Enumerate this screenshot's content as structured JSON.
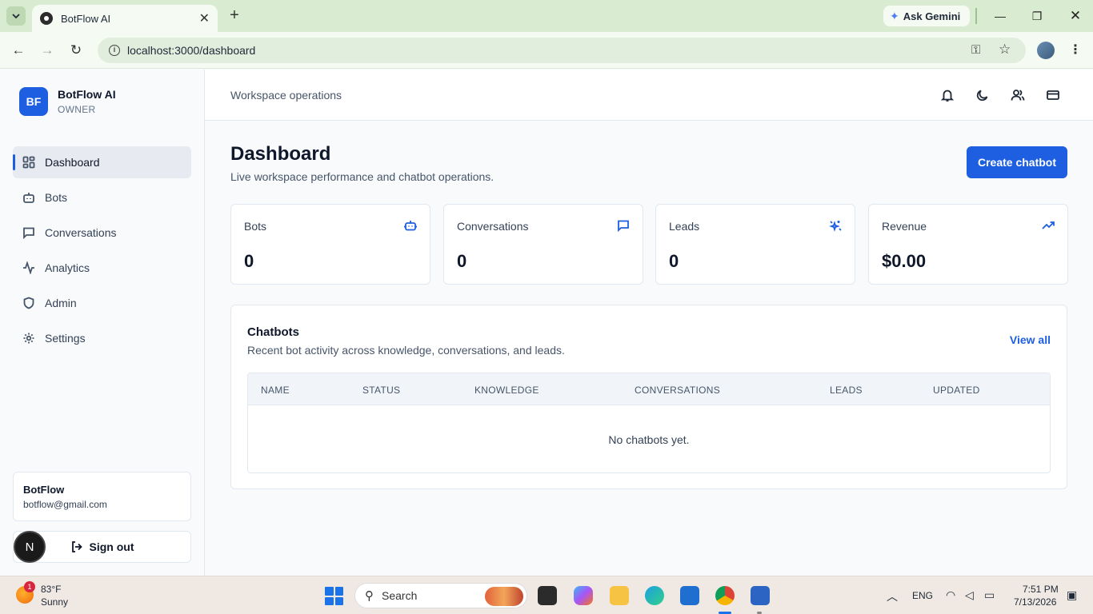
{
  "browser": {
    "tab_title": "BotFlow AI",
    "url": "localhost:3000/dashboard",
    "gemini_label": "Ask Gemini"
  },
  "sidebar": {
    "logo_initials": "BF",
    "brand_name": "BotFlow AI",
    "role": "OWNER",
    "items": [
      {
        "label": "Dashboard",
        "icon": "dashboard-icon"
      },
      {
        "label": "Bots",
        "icon": "bot-icon"
      },
      {
        "label": "Conversations",
        "icon": "message-icon"
      },
      {
        "label": "Analytics",
        "icon": "activity-icon"
      },
      {
        "label": "Admin",
        "icon": "shield-icon"
      },
      {
        "label": "Settings",
        "icon": "gear-icon"
      }
    ],
    "user_name": "BotFlow",
    "user_email": "botflow@gmail.com",
    "signout_label": "Sign out",
    "next_badge": "N"
  },
  "topbar": {
    "section": "Workspace operations"
  },
  "page": {
    "title": "Dashboard",
    "subtitle": "Live workspace performance and chatbot operations.",
    "create_label": "Create chatbot"
  },
  "stats": [
    {
      "label": "Bots",
      "value": "0",
      "icon": "bot-icon"
    },
    {
      "label": "Conversations",
      "value": "0",
      "icon": "message-icon"
    },
    {
      "label": "Leads",
      "value": "0",
      "icon": "sparkle-icon"
    },
    {
      "label": "Revenue",
      "value": "$0.00",
      "icon": "trending-up-icon"
    }
  ],
  "chatbots": {
    "title": "Chatbots",
    "subtitle": "Recent bot activity across knowledge, conversations, and leads.",
    "view_all": "View all",
    "columns": [
      "NAME",
      "STATUS",
      "KNOWLEDGE",
      "CONVERSATIONS",
      "LEADS",
      "UPDATED"
    ],
    "empty_text": "No chatbots yet."
  },
  "taskbar": {
    "weather_temp": "83°F",
    "weather_cond": "Sunny",
    "weather_badge": "1",
    "search_label": "Search",
    "language": "ENG",
    "time": "7:51 PM",
    "date": "7/13/2026"
  },
  "colors": {
    "accent": "#1d5fe0",
    "browser_chrome": "#d9ecd1"
  }
}
